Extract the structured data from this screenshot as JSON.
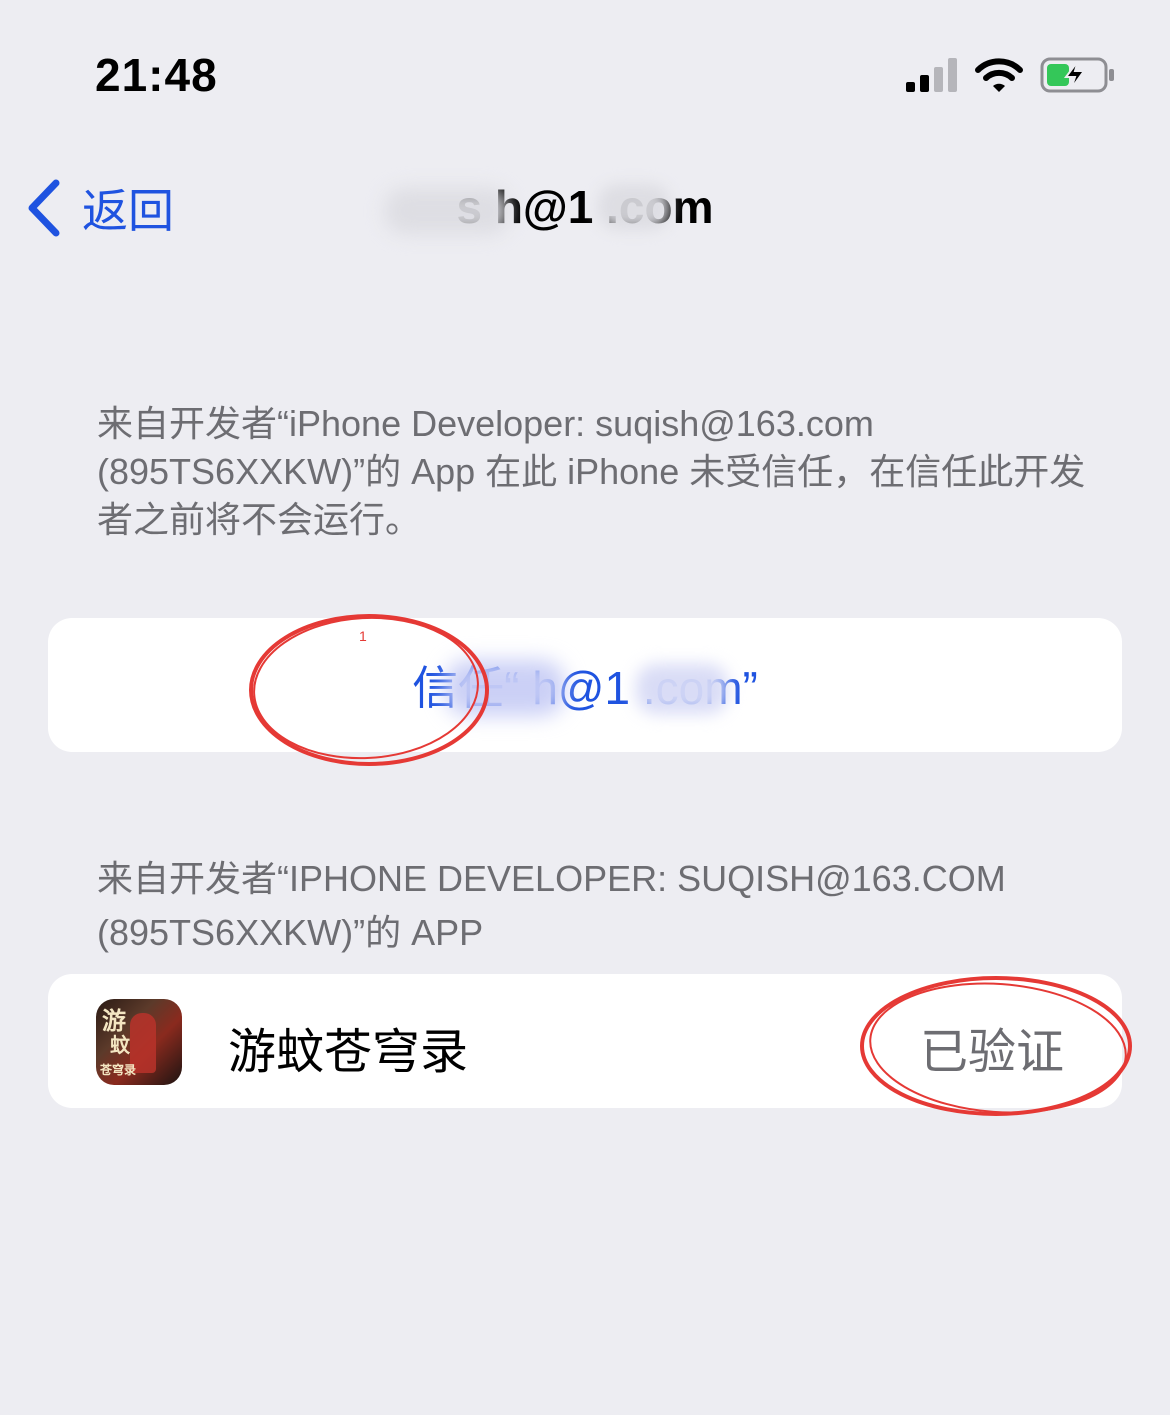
{
  "status_bar": {
    "time": "21:48"
  },
  "nav": {
    "back_label": "返回",
    "title": "s    h@1  .com"
  },
  "description": "来自开发者“iPhone Developer: suqish@163.com (895TS6XXKW)”的 App 在此 iPhone 未受信任，在信任此开发者之前将不会运行。",
  "trust_button": {
    "label": "信任“     h@1  .com”"
  },
  "apps_section": {
    "header": "来自开发者“IPHONE DEVELOPER: SUQISH@163.COM (895TS6XXKW)”的 APP",
    "apps": [
      {
        "name": "游蚊苍穹录",
        "status": "已验证",
        "icon_text": [
          "游",
          "蚊",
          "苍穹录"
        ]
      }
    ]
  },
  "annotations": {
    "marker_number": "1",
    "color": "#e53935"
  },
  "colors": {
    "background": "#ededf2",
    "accent": "#1f53e0",
    "secondary_text": "#6d6d72",
    "battery_fill": "#34c759"
  }
}
